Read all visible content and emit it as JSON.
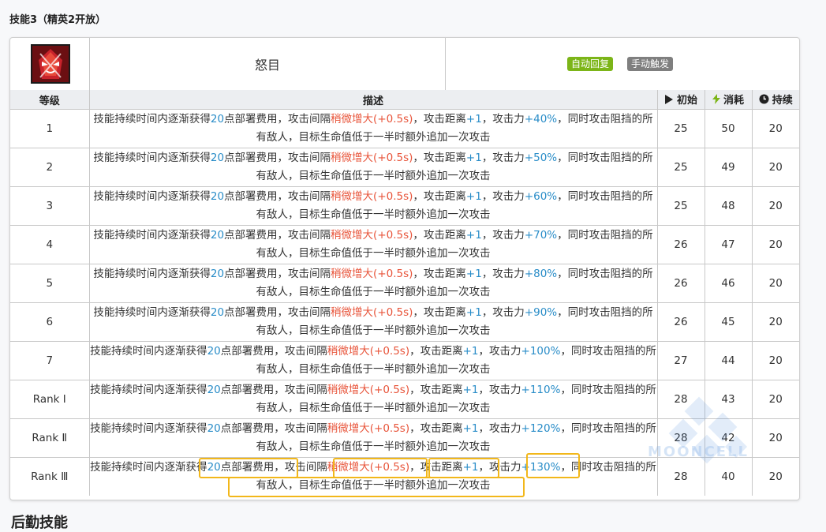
{
  "section": {
    "title": "技能3（精英2开放）"
  },
  "skill": {
    "name": "怒目",
    "tags": [
      "自动回复",
      "手动触发"
    ],
    "icon": "skill-icon",
    "colors": {
      "tag_green": "#7cb518",
      "tag_gray": "#7f7f7f",
      "highlight_blue": "#2a8dc8",
      "highlight_red": "#e8543a",
      "annotation_box": "#f2b71a"
    }
  },
  "table": {
    "headers": {
      "level": "等级",
      "desc": "描述",
      "initial": "初始",
      "cost": "消耗",
      "duration": "持续"
    },
    "header_icons": {
      "initial": "play-icon",
      "cost": "lightning-icon",
      "duration": "clock-icon"
    },
    "desc_parts": {
      "p1": "技能持续时间内逐渐获得",
      "sp": "20",
      "p2": "点部署费用，攻击间隔",
      "interval": "稍微增大(+0.5s)",
      "p3": "，攻击距离",
      "range": "+1",
      "p4": "，攻击力",
      "p5": "，同时攻击阻挡的所有敌人，目标生命值低于一半时额外追加一次攻击"
    },
    "rows": [
      {
        "level": "1",
        "atk": "+40%",
        "initial": "25",
        "cost": "50",
        "duration": "20"
      },
      {
        "level": "2",
        "atk": "+50%",
        "initial": "25",
        "cost": "49",
        "duration": "20"
      },
      {
        "level": "3",
        "atk": "+60%",
        "initial": "25",
        "cost": "48",
        "duration": "20"
      },
      {
        "level": "4",
        "atk": "+70%",
        "initial": "26",
        "cost": "47",
        "duration": "20"
      },
      {
        "level": "5",
        "atk": "+80%",
        "initial": "26",
        "cost": "46",
        "duration": "20"
      },
      {
        "level": "6",
        "atk": "+90%",
        "initial": "26",
        "cost": "45",
        "duration": "20"
      },
      {
        "level": "7",
        "atk": "+100%",
        "initial": "27",
        "cost": "44",
        "duration": "20"
      },
      {
        "level": "Rank Ⅰ",
        "atk": "+110%",
        "initial": "28",
        "cost": "43",
        "duration": "20"
      },
      {
        "level": "Rank Ⅱ",
        "atk": "+120%",
        "initial": "28",
        "cost": "42",
        "duration": "20"
      },
      {
        "level": "Rank Ⅲ",
        "atk": "+130%",
        "initial": "28",
        "cost": "40",
        "duration": "20"
      }
    ]
  },
  "watermark": "MOONCELL",
  "next_section": {
    "title": "后勤技能"
  }
}
